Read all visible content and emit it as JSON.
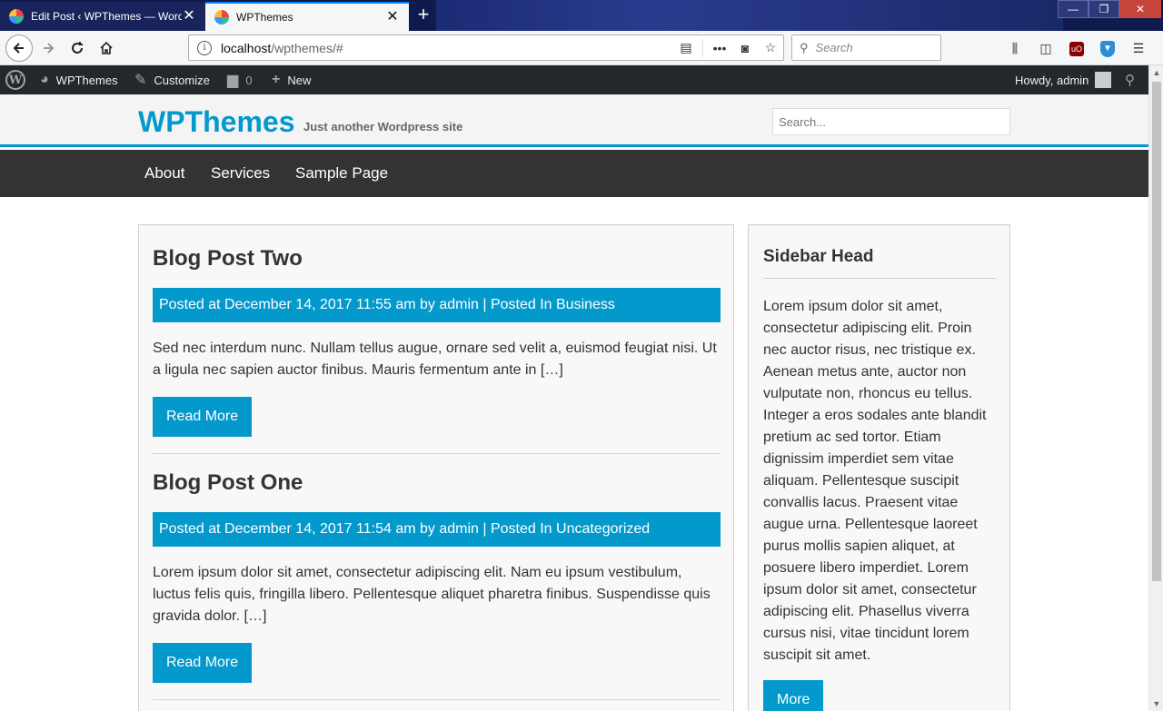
{
  "browser": {
    "tabs": [
      {
        "title": "Edit Post ‹ WPThemes — Word",
        "close": "✕"
      },
      {
        "title": "WPThemes",
        "close": "✕"
      }
    ],
    "new_tab": "+",
    "url_host": "localhost",
    "url_path": "/wpthemes/#",
    "search_placeholder": "Search",
    "window_controls": {
      "minimize": "—",
      "maximize": "❐",
      "close": "✕"
    }
  },
  "adminbar": {
    "logo": "W",
    "site_name": "WPThemes",
    "customize": "Customize",
    "comments_count": "0",
    "new_label": "New",
    "howdy": "Howdy, admin"
  },
  "site": {
    "title": "WPThemes",
    "tagline": "Just another Wordpress site",
    "search_placeholder": "Search...",
    "accent_color": "#0399cc"
  },
  "nav": {
    "items": [
      "About",
      "Services",
      "Sample Page"
    ]
  },
  "posts": [
    {
      "title": "Blog Post Two",
      "meta": "Posted at December 14, 2017 11:55 am by admin | Posted In Business",
      "excerpt": "Sed nec interdum nunc. Nullam tellus augue, ornare sed velit a, euismod feugiat nisi. Ut a ligula nec sapien auctor finibus. Mauris fermentum ante in […]",
      "read_more": "Read More"
    },
    {
      "title": "Blog Post One",
      "meta": "Posted at December 14, 2017 11:54 am by admin | Posted In Uncategorized",
      "excerpt": "Lorem ipsum dolor sit amet, consectetur adipiscing elit. Nam eu ipsum vestibulum, luctus felis quis, fringilla libero. Pellentesque aliquet pharetra finibus. Suspendisse quis gravida dolor. […]",
      "read_more": "Read More"
    }
  ],
  "sidebar": {
    "head": "Sidebar Head",
    "text": "Lorem ipsum dolor sit amet, consectetur adipiscing elit. Proin nec auctor risus, nec tristique ex. Aenean metus ante, auctor non vulputate non, rhoncus eu tellus. Integer a eros sodales ante blandit pretium ac sed tortor. Etiam dignissim imperdiet sem vitae aliquam. Pellentesque suscipit convallis lacus. Praesent vitae augue urna. Pellentesque laoreet purus mollis sapien aliquet, at posuere libero imperdiet. Lorem ipsum dolor sit amet, consectetur adipiscing elit. Phasellus viverra cursus nisi, vitae tincidunt lorem suscipit sit amet.",
    "more_button": "More"
  }
}
